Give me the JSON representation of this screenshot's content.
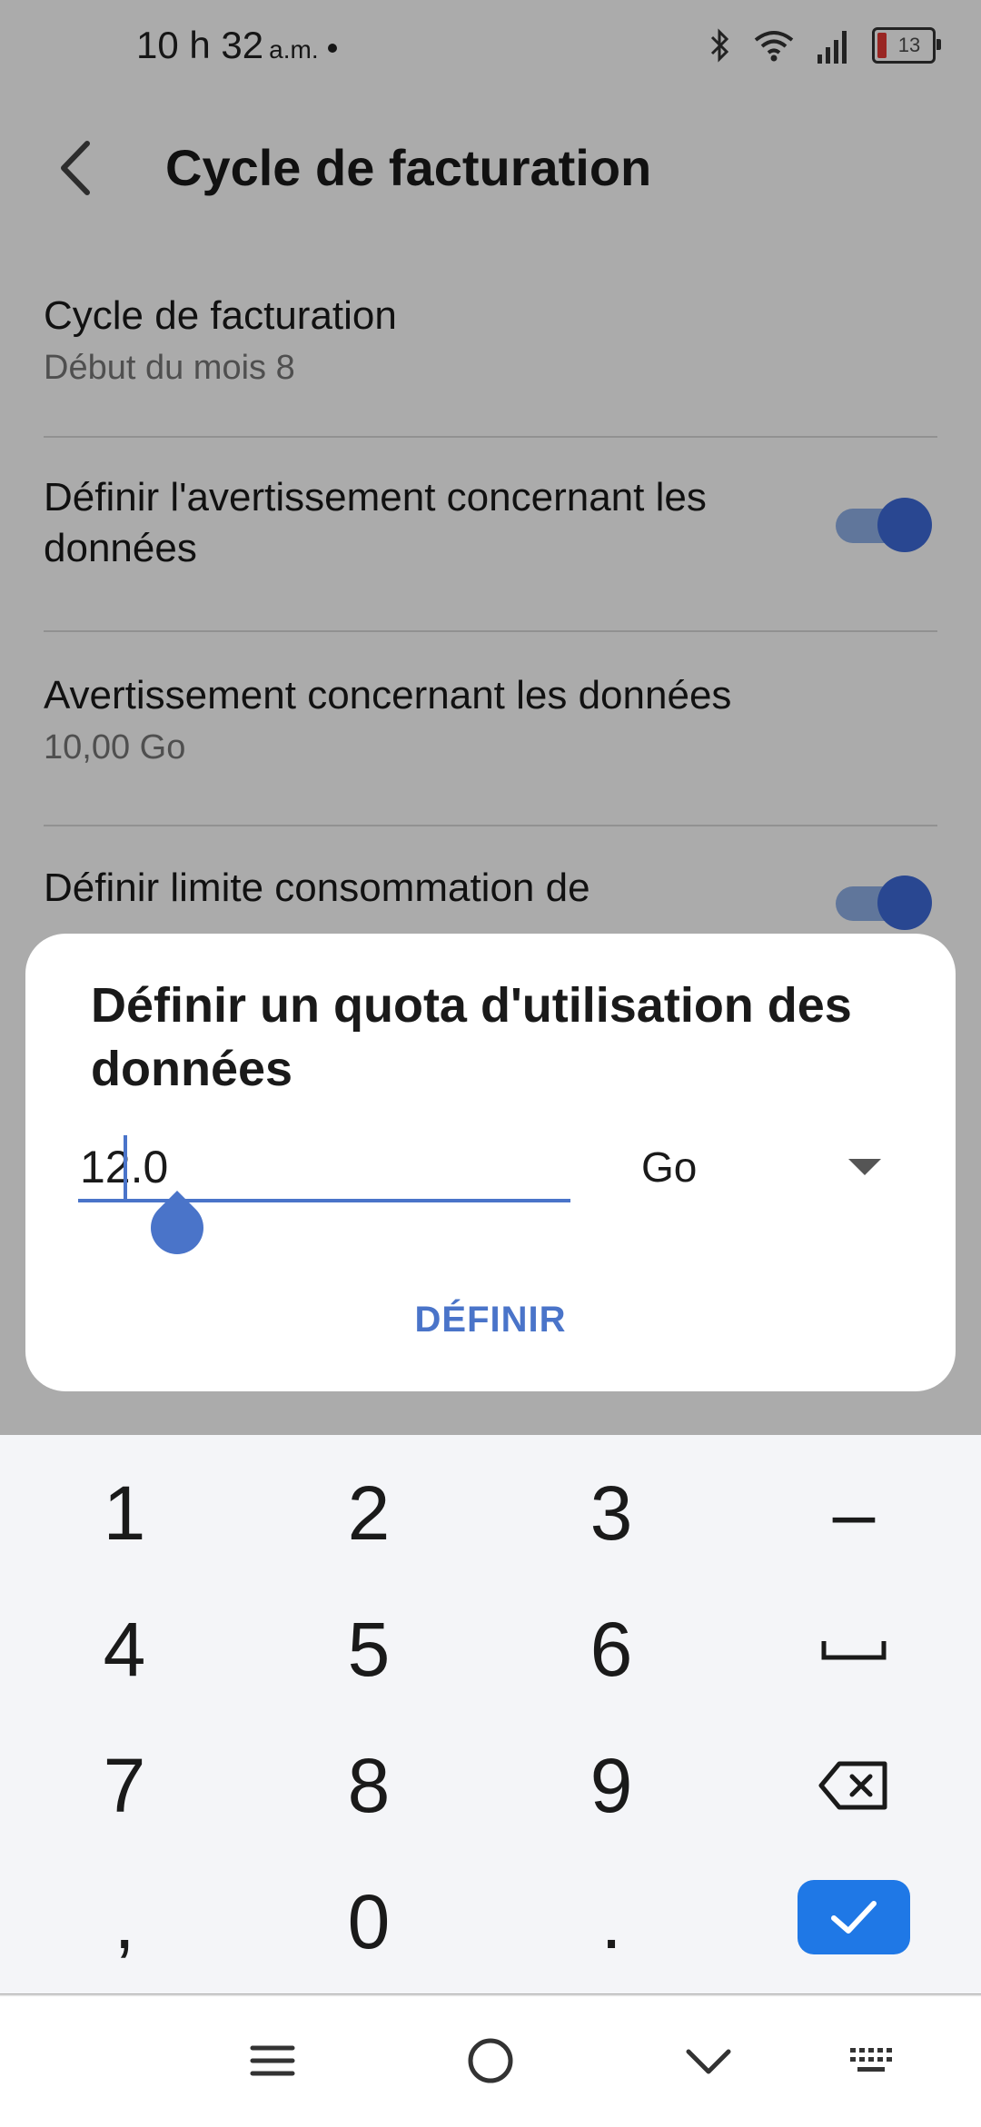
{
  "status_bar": {
    "time": "10 h 32",
    "ampm": "a.m.",
    "battery": "13"
  },
  "appbar": {
    "title": "Cycle de facturation"
  },
  "settings": {
    "items": [
      {
        "title": "Cycle de facturation",
        "subtitle": "Début du mois 8"
      },
      {
        "title": "Définir l'avertissement concernant les données",
        "toggle_on": true
      },
      {
        "title": "Avertissement concernant les données",
        "subtitle": "10,00 Go"
      },
      {
        "title": "Définir limite consommation de",
        "toggle_on": true
      }
    ]
  },
  "dialog": {
    "title": "Définir un quota d'utilisation des données",
    "input_value": "12.0",
    "unit": "Go",
    "define_label": "DÉFINIR"
  },
  "keyboard": {
    "keys": [
      "1",
      "2",
      "3",
      "–",
      "4",
      "5",
      "6",
      "␣",
      "7",
      "8",
      "9",
      "⌫",
      ",",
      "0",
      "."
    ]
  },
  "colors": {
    "accent": "#4a74c9",
    "ok_button": "#1f78e6",
    "toggle_thumb": "#3e6ad8"
  }
}
